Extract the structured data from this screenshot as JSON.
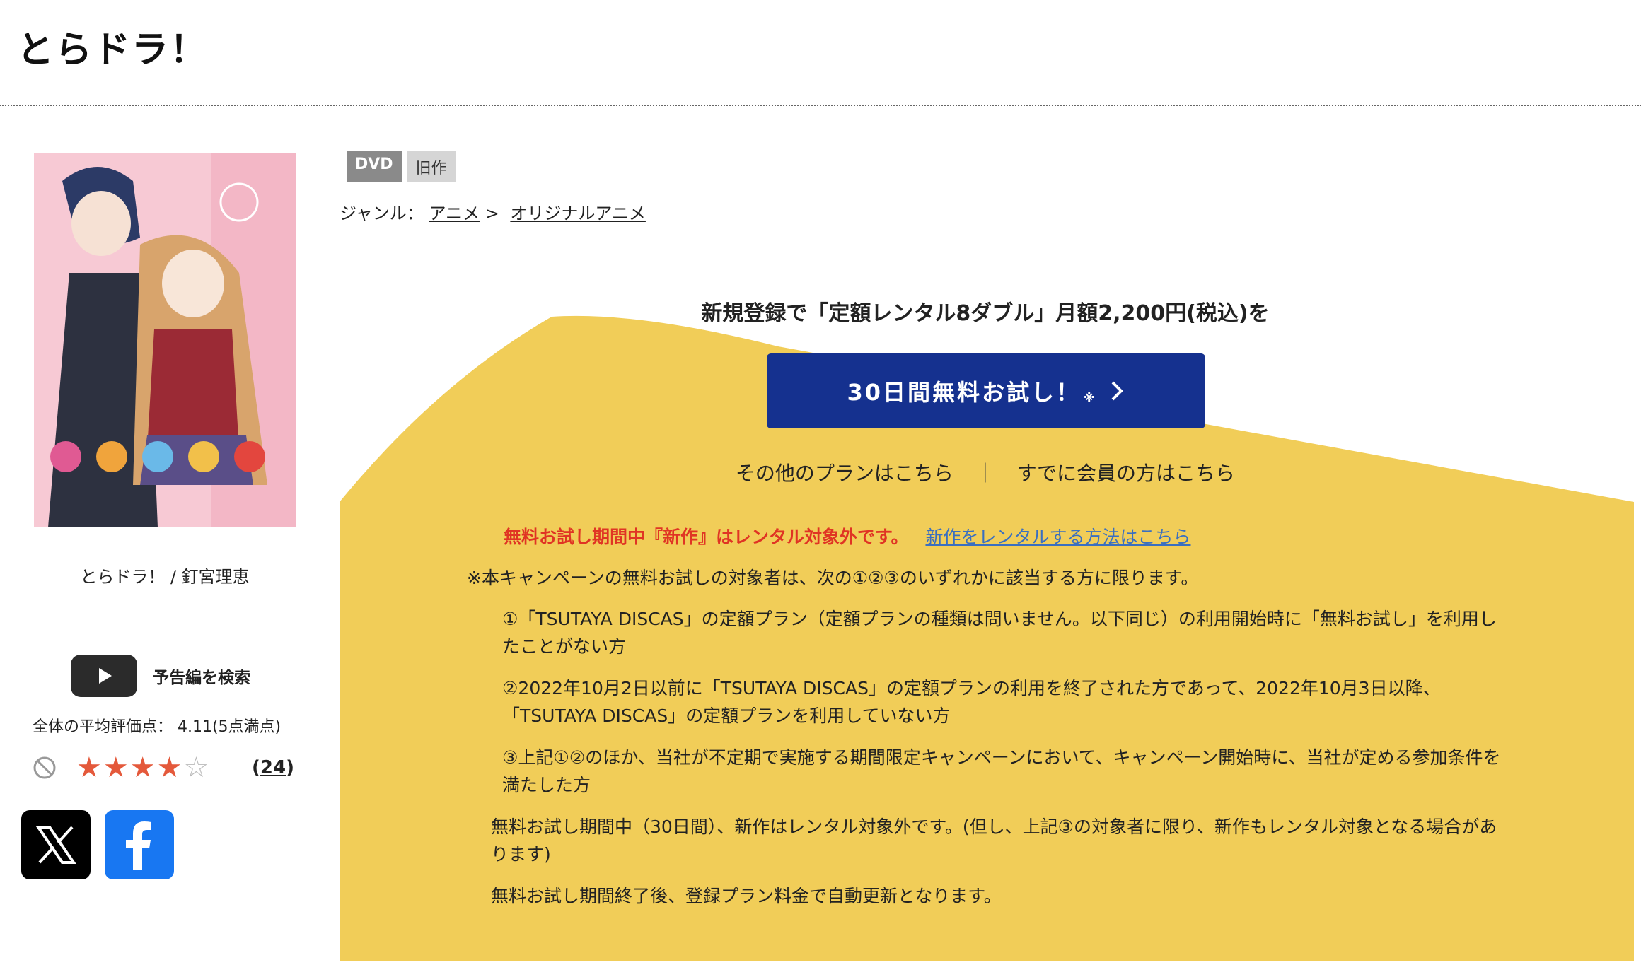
{
  "page_title": "とらドラ！",
  "work_caption": "とらドラ！ / 釘宮理恵",
  "trailer": {
    "label": "予告編を検索"
  },
  "rating": {
    "average_label": "全体の平均評価点： 4.11(5点満点)",
    "stars_filled": 4,
    "stars_total": 5,
    "review_count": "24",
    "review_count_open": "(",
    "review_count_close": ")"
  },
  "badges": {
    "format": "DVD",
    "status": "旧作"
  },
  "genre": {
    "label": "ジャンル：",
    "items": [
      "アニメ",
      "オリジナルアニメ"
    ],
    "separator": ">"
  },
  "promo": {
    "headline": "新規登録で「定額レンタル8ダブル」月額2,200円(税込)を",
    "button_label": "30日間無料お試し！",
    "button_note": "※",
    "other_plans": "その他のプランはこちら",
    "separator": "｜",
    "member_link": "すでに会員の方はこちら",
    "warning": "無料お試し期間中『新作』はレンタル対象外です。",
    "warning_link": "新作をレンタルする方法はこちら",
    "conditions_intro": "※本キャンペーンの無料お試しの対象者は、次の①②③のいずれかに該当する方に限ります。",
    "condition_1": "①「TSUTAYA DISCAS」の定額プラン（定額プランの種類は問いません。以下同じ）の利用開始時に「無料お試し」を利用したことがない方",
    "condition_2": "②2022年10月2日以前に「TSUTAYA DISCAS」の定額プランの利用を終了された方であって、2022年10月3日以降、「TSUTAYA DISCAS」の定額プランを利用していない方",
    "condition_3": "③上記①②のほか、当社が不定期で実施する期間限定キャンペーンにおいて、キャンペーン開始時に、当社が定める参加条件を満たした方",
    "note_new_titles": "無料お試し期間中（30日間）、新作はレンタル対象外です。(但し、上記③の対象者に限り、新作もレンタル対象となる場合があります)",
    "note_renewal": "無料お試し期間終了後、登録プラン料金で自動更新となります。"
  },
  "colors": {
    "promo_yellow": "#f1cd58",
    "button_blue": "#15318f",
    "warning_red": "#e03424",
    "link_blue": "#3a6fc0",
    "star_orange": "#e4593b"
  }
}
